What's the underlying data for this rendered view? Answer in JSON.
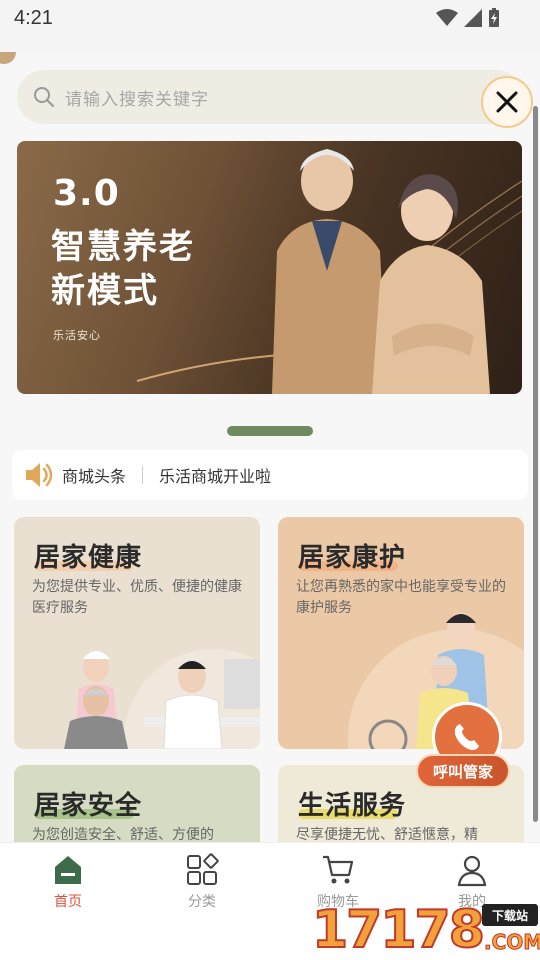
{
  "status_bar": {
    "time": "4:21"
  },
  "search": {
    "placeholder": "请输入搜索关键字"
  },
  "banner": {
    "title_number": "3.0",
    "title_line1": "智慧养老",
    "title_line2": "新模式",
    "subtitle": "乐活安心"
  },
  "news": {
    "label": "商城头条",
    "text": "乐活商城开业啦"
  },
  "cards": [
    {
      "title": "居家健康",
      "desc": "为您提供专业、优质、便捷的健康医疗服务"
    },
    {
      "title": "居家康护",
      "desc": "让您再熟悉的家中也能享受专业的康护服务"
    },
    {
      "title": "居家安全",
      "desc": "为您创造安全、舒适、方便的"
    },
    {
      "title": "生活服务",
      "desc": "尽享便捷无忧、舒适惬意，精"
    }
  ],
  "float_button": {
    "label": "呼叫管家"
  },
  "tabs": [
    {
      "label": "首页",
      "active": true
    },
    {
      "label": "分类",
      "active": false
    },
    {
      "label": "购物车",
      "active": false
    },
    {
      "label": "我的",
      "active": false
    }
  ],
  "watermark": {
    "number": "17178",
    "tag": "下载站",
    "suffix": ".COM"
  },
  "colors": {
    "accent_active": "#e0533a",
    "indicator": "#6f8a5e",
    "card_health": "#e9e0d2",
    "card_care": "#ecc9a6",
    "card_safety": "#d5dcc3",
    "card_life": "#efe9d7"
  }
}
